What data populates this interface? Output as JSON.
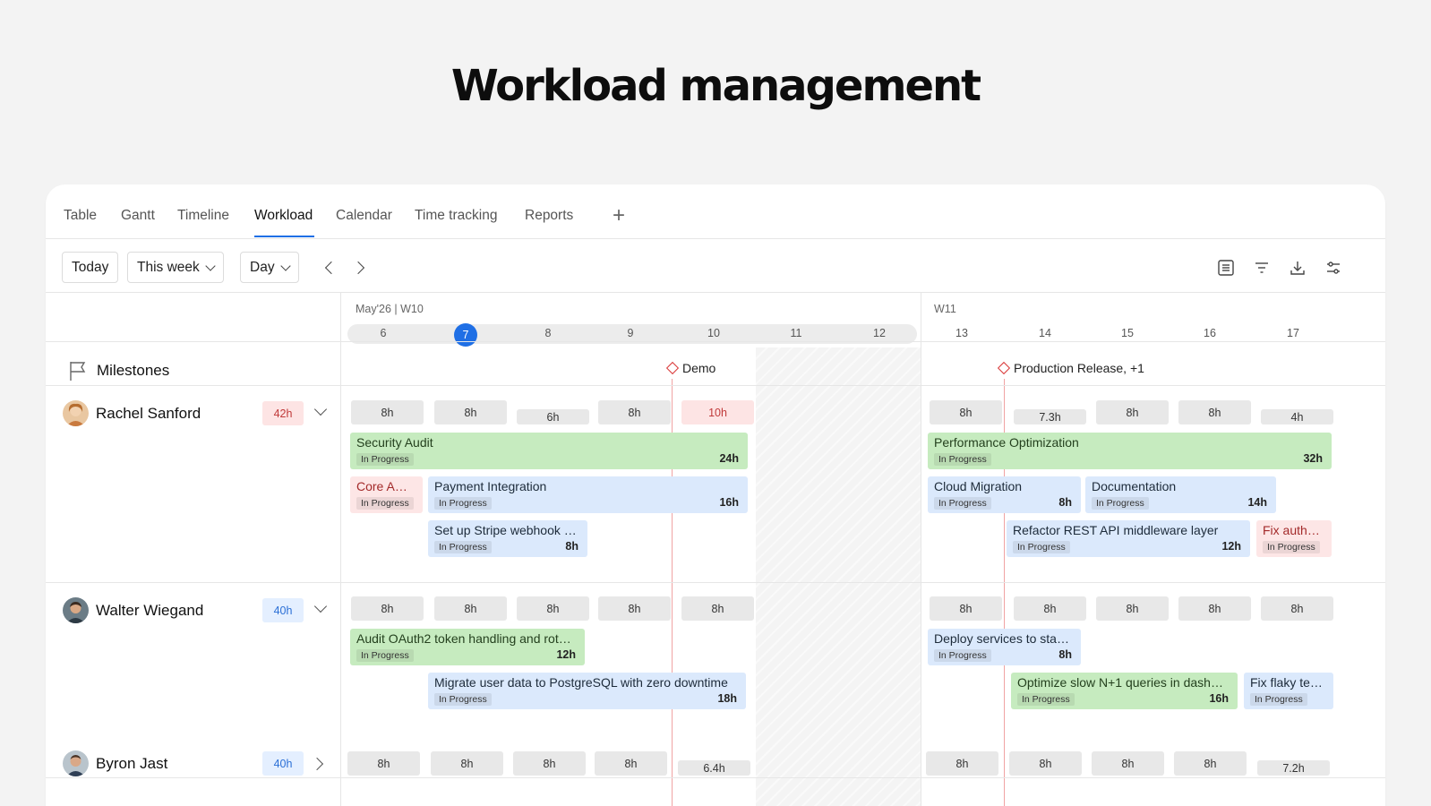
{
  "hero_title": "Workload management",
  "tabs": [
    "Table",
    "Gantt",
    "Timeline",
    "Workload",
    "Calendar",
    "Time tracking",
    "Reports"
  ],
  "active_tab": "Workload",
  "toolbar": {
    "today": "Today",
    "range": "This week",
    "scale": "Day"
  },
  "timeline": {
    "week1_label": "May'26 | W10",
    "week2_label": "W11",
    "days": [
      "6",
      "7",
      "8",
      "9",
      "10",
      "11",
      "12",
      "13",
      "14",
      "15",
      "16",
      "17"
    ],
    "today": "7"
  },
  "milestones": {
    "label": "Milestones",
    "items": [
      {
        "name": "Demo"
      },
      {
        "name": "Production Release, +1"
      }
    ]
  },
  "people": [
    {
      "name": "Rachel Sanford",
      "total": "42h",
      "status": "over",
      "caps": [
        "8h",
        "8h",
        "6h",
        "8h",
        "10h",
        "8h",
        "7.3h",
        "8h",
        "8h",
        "4h"
      ],
      "tasks": [
        {
          "title": "Security Audit",
          "status": "In Progress",
          "hours": "24h",
          "color": "green"
        },
        {
          "title": "Core API…",
          "status": "In Progress",
          "hours": "",
          "color": "pink"
        },
        {
          "title": "Payment Integration",
          "status": "In Progress",
          "hours": "16h",
          "color": "blue"
        },
        {
          "title": "Set up Stripe webhook h…",
          "status": "In Progress",
          "hours": "8h",
          "color": "blue"
        },
        {
          "title": "Performance Optimization",
          "status": "In Progress",
          "hours": "32h",
          "color": "green"
        },
        {
          "title": "Cloud Migration",
          "status": "In Progress",
          "hours": "8h",
          "color": "blue"
        },
        {
          "title": "Documentation",
          "status": "In Progress",
          "hours": "14h",
          "color": "blue"
        },
        {
          "title": "Refactor REST API middleware layer",
          "status": "In Progress",
          "hours": "12h",
          "color": "blue"
        },
        {
          "title": "Fix auth b…",
          "status": "In Progress",
          "hours": "",
          "color": "pink"
        }
      ]
    },
    {
      "name": "Walter Wiegand",
      "total": "40h",
      "status": "ok",
      "caps": [
        "8h",
        "8h",
        "8h",
        "8h",
        "8h",
        "8h",
        "8h",
        "8h",
        "8h",
        "8h"
      ],
      "tasks": [
        {
          "title": "Audit OAuth2 token handling and rotat…",
          "status": "In Progress",
          "hours": "12h",
          "color": "green"
        },
        {
          "title": "Migrate user data to PostgreSQL with zero downtime",
          "status": "In Progress",
          "hours": "18h",
          "color": "blue"
        },
        {
          "title": "Deploy services to stagi…",
          "status": "In Progress",
          "hours": "8h",
          "color": "blue"
        },
        {
          "title": "Optimize slow N+1 queries in dashbo…",
          "status": "In Progress",
          "hours": "16h",
          "color": "green"
        },
        {
          "title": "Fix flaky tes…",
          "status": "In Progress",
          "hours": "",
          "color": "blue"
        }
      ]
    },
    {
      "name": "Byron Jast",
      "total": "40h",
      "status": "ok",
      "caps": [
        "8h",
        "8h",
        "8h",
        "8h",
        "6.4h",
        "8h",
        "8h",
        "8h",
        "8h",
        "7.2h"
      ]
    }
  ]
}
